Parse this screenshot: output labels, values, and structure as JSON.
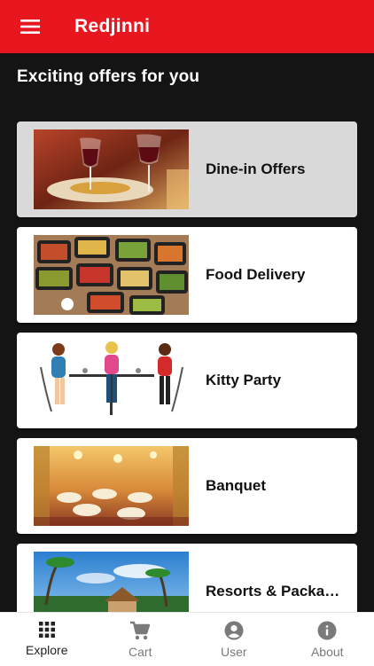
{
  "app": {
    "title": "Redjinni"
  },
  "section": {
    "heading": "Exciting offers for you"
  },
  "offers": [
    {
      "label": "Dine-in Offers",
      "image": "dine-in-photo"
    },
    {
      "label": "Food Delivery",
      "image": "food-delivery-photo"
    },
    {
      "label": "Kitty Party",
      "image": "kitty-party-illustration"
    },
    {
      "label": "Banquet",
      "image": "banquet-hall-photo"
    },
    {
      "label": "Resorts & Packages",
      "image": "resort-photo"
    }
  ],
  "nav": {
    "items": [
      {
        "label": "Explore",
        "icon": "grid-icon"
      },
      {
        "label": "Cart",
        "icon": "cart-icon"
      },
      {
        "label": "User",
        "icon": "user-icon"
      },
      {
        "label": "About",
        "icon": "info-icon"
      }
    ]
  },
  "colors": {
    "brand": "#e8161f",
    "background": "#141414",
    "selected_card": "#d9d9d9"
  }
}
